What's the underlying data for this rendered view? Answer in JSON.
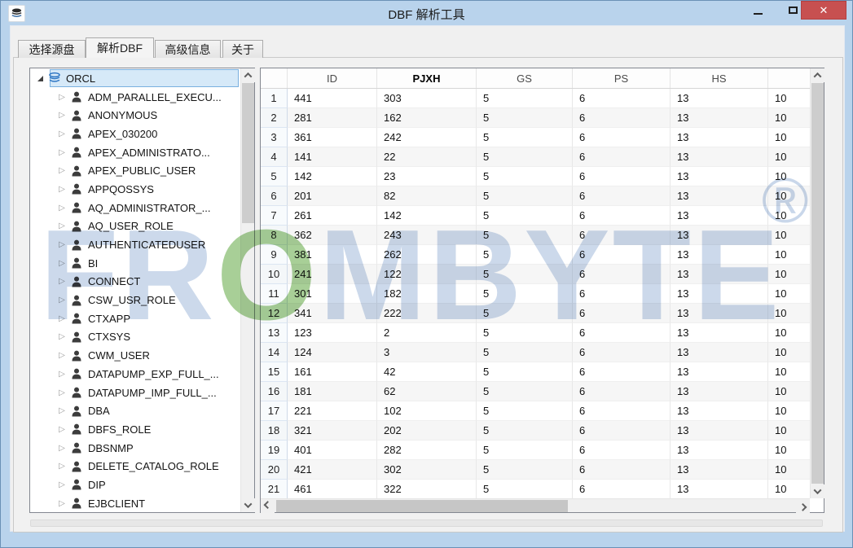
{
  "window": {
    "title": "DBF 解析工具",
    "close_glyph": "✕"
  },
  "tabs": [
    {
      "label": "选择源盘",
      "active": false
    },
    {
      "label": "解析DBF",
      "active": true
    },
    {
      "label": "高级信息",
      "active": false
    },
    {
      "label": "关于",
      "active": false
    }
  ],
  "tree": {
    "root_label": "ORCL",
    "items": [
      "ADM_PARALLEL_EXECU...",
      "ANONYMOUS",
      "APEX_030200",
      "APEX_ADMINISTRATO...",
      "APEX_PUBLIC_USER",
      "APPQOSSYS",
      "AQ_ADMINISTRATOR_...",
      "AQ_USER_ROLE",
      "AUTHENTICATEDUSER",
      "BI",
      "CONNECT",
      "CSW_USR_ROLE",
      "CTXAPP",
      "CTXSYS",
      "CWM_USER",
      "DATAPUMP_EXP_FULL_...",
      "DATAPUMP_IMP_FULL_...",
      "DBA",
      "DBFS_ROLE",
      "DBSNMP",
      "DELETE_CATALOG_ROLE",
      "DIP",
      "EJBCLIENT"
    ]
  },
  "table": {
    "columns": [
      "",
      "ID",
      "PJXH",
      "GS",
      "PS",
      "HS",
      ""
    ],
    "bold_column": "PJXH",
    "rows": [
      [
        "1",
        "441",
        "303",
        "5",
        "6",
        "13",
        "10"
      ],
      [
        "2",
        "281",
        "162",
        "5",
        "6",
        "13",
        "10"
      ],
      [
        "3",
        "361",
        "242",
        "5",
        "6",
        "13",
        "10"
      ],
      [
        "4",
        "141",
        "22",
        "5",
        "6",
        "13",
        "10"
      ],
      [
        "5",
        "142",
        "23",
        "5",
        "6",
        "13",
        "10"
      ],
      [
        "6",
        "201",
        "82",
        "5",
        "6",
        "13",
        "10"
      ],
      [
        "7",
        "261",
        "142",
        "5",
        "6",
        "13",
        "10"
      ],
      [
        "8",
        "362",
        "243",
        "5",
        "6",
        "13",
        "10"
      ],
      [
        "9",
        "381",
        "262",
        "5",
        "6",
        "13",
        "10"
      ],
      [
        "10",
        "241",
        "122",
        "5",
        "6",
        "13",
        "10"
      ],
      [
        "11",
        "301",
        "182",
        "5",
        "6",
        "13",
        "10"
      ],
      [
        "12",
        "341",
        "222",
        "5",
        "6",
        "13",
        "10"
      ],
      [
        "13",
        "123",
        "2",
        "5",
        "6",
        "13",
        "10"
      ],
      [
        "14",
        "124",
        "3",
        "5",
        "6",
        "13",
        "10"
      ],
      [
        "15",
        "161",
        "42",
        "5",
        "6",
        "13",
        "10"
      ],
      [
        "16",
        "181",
        "62",
        "5",
        "6",
        "13",
        "10"
      ],
      [
        "17",
        "221",
        "102",
        "5",
        "6",
        "13",
        "10"
      ],
      [
        "18",
        "321",
        "202",
        "5",
        "6",
        "13",
        "10"
      ],
      [
        "19",
        "401",
        "282",
        "5",
        "6",
        "13",
        "10"
      ],
      [
        "20",
        "421",
        "302",
        "5",
        "6",
        "13",
        "10"
      ],
      [
        "21",
        "461",
        "322",
        "5",
        "6",
        "13",
        "10"
      ]
    ]
  },
  "watermark": {
    "left": "FR",
    "o": "O",
    "right": "MBYTE",
    "registered": "®"
  },
  "colors": {
    "titlebar": "#b9d3ec",
    "close_button": "#c75050",
    "selection_fill": "#d6e9f8",
    "selection_border": "#7ab0df",
    "watermark_blue": "#ccd9eb",
    "watermark_green": "#a8cf97",
    "tree_root_icon": "#2e76c4"
  }
}
